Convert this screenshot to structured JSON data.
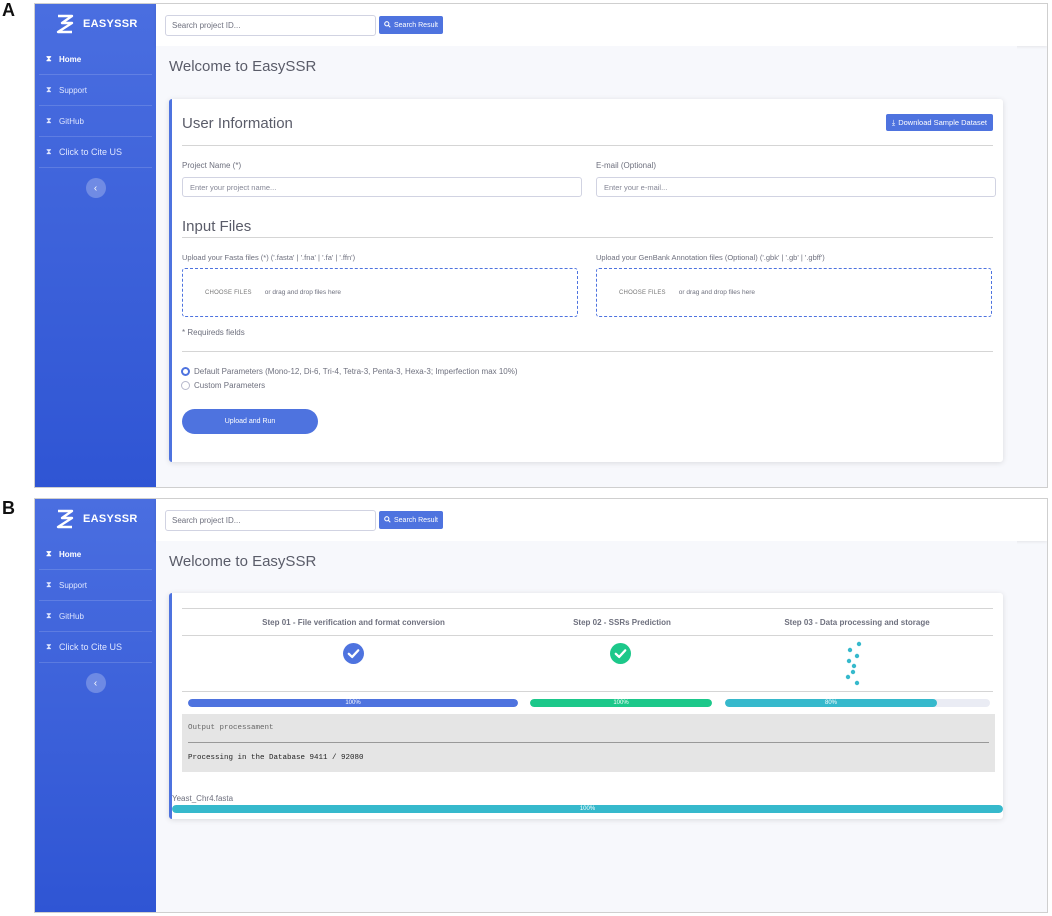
{
  "panels": [
    {
      "letter": "A"
    },
    {
      "letter": "B"
    }
  ],
  "app": {
    "brand": "EASYSSR",
    "search_placeholder": "Search project ID...",
    "search_button": "Search Result",
    "page_title": "Welcome to EasySSR"
  },
  "sidebar": {
    "items": [
      {
        "label": "Home"
      },
      {
        "label": "Support"
      },
      {
        "label": "GitHub"
      },
      {
        "label": "Click to Cite US"
      }
    ],
    "collapse_glyph": "‹"
  },
  "form": {
    "user_info_title": "User Information",
    "download_button": "Download Sample Dataset",
    "project_name_label": "Project Name (*)",
    "project_name_placeholder": "Enter your project name...",
    "email_label": "E-mail (Optional)",
    "email_placeholder": "Enter your e-mail...",
    "input_files_title": "Input Files",
    "fasta_label": "Upload your Fasta files (*) ('.fasta' | '.fna' | '.fa' | '.ffn')",
    "genbank_label": "Upload your GenBank Annotation files (Optional) ('.gbk' | '.gb' | '.gbff')",
    "choose_files": "CHOOSE FILES",
    "drag_text": "or drag and drop files here",
    "required_note": "* Requireds fields",
    "default_params": "Default Parameters (Mono-12, Di-6, Tri-4, Tetra-3, Penta-3, Hexa-3; Imperfection max 10%)",
    "custom_params": "Custom Parameters",
    "selected_param": "default",
    "run_button": "Upload and Run"
  },
  "progress": {
    "steps": [
      {
        "title": "Step 01 - File verification and format conversion",
        "status": "done",
        "percent": 100,
        "label": "100%",
        "color": "#4e73df"
      },
      {
        "title": "Step 02 - SSRs Prediction",
        "status": "done",
        "percent": 100,
        "label": "100%",
        "color": "#1cc88a"
      },
      {
        "title": "Step 03 - Data processing and storage",
        "status": "loading",
        "percent": 80,
        "label": "80%",
        "color": "#36b9cc"
      }
    ],
    "output_header": "Output processament",
    "output_text": "Processing in the Database 9411 / 92080",
    "file_name": "Yeast_Chr4.fasta",
    "file_percent": 100,
    "file_label": "100%",
    "file_color": "#36b9cc"
  },
  "colors": {
    "primary": "#4e73df",
    "success": "#1cc88a",
    "info": "#36b9cc"
  }
}
